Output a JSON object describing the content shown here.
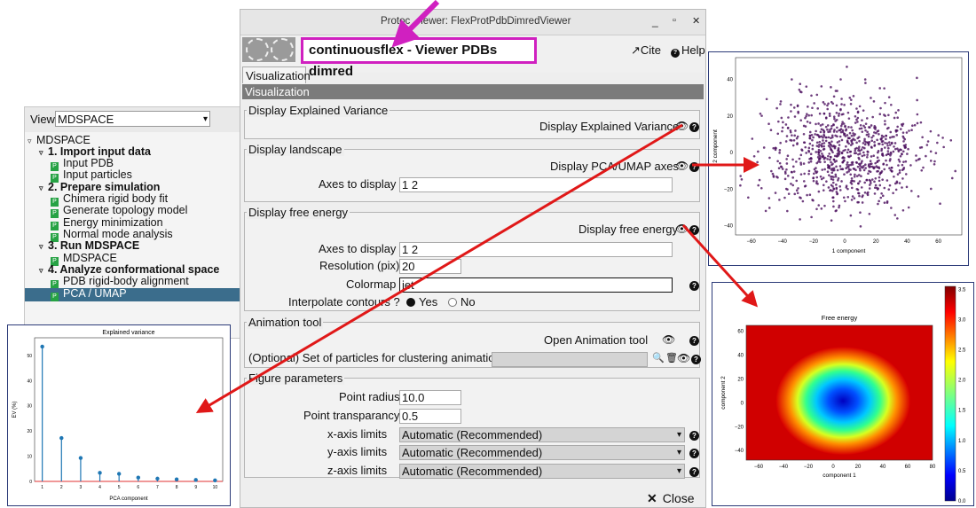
{
  "tree": {
    "view_label": "View",
    "view_value": "MDSPACE",
    "nodes": [
      {
        "label": "MDSPACE",
        "bold": false,
        "toggle": true,
        "proto": false
      },
      {
        "label": "1. Import input data",
        "bold": true,
        "toggle": true,
        "proto": false
      },
      {
        "label": "Input PDB",
        "bold": false,
        "toggle": false,
        "proto": true
      },
      {
        "label": "Input particles",
        "bold": false,
        "toggle": false,
        "proto": true
      },
      {
        "label": "2. Prepare simulation",
        "bold": true,
        "toggle": true,
        "proto": false
      },
      {
        "label": "Chimera rigid body fit",
        "bold": false,
        "toggle": false,
        "proto": true
      },
      {
        "label": "Generate topology model",
        "bold": false,
        "toggle": false,
        "proto": true
      },
      {
        "label": "Energy minimization",
        "bold": false,
        "toggle": false,
        "proto": true
      },
      {
        "label": "Normal mode analysis",
        "bold": false,
        "toggle": false,
        "proto": true
      },
      {
        "label": "3. Run MDSPACE",
        "bold": true,
        "toggle": true,
        "proto": false
      },
      {
        "label": "MDSPACE",
        "bold": false,
        "toggle": false,
        "proto": true
      },
      {
        "label": "4. Analyze conformational space",
        "bold": true,
        "toggle": true,
        "proto": false
      },
      {
        "label": "PDB rigid-body alignment",
        "bold": false,
        "toggle": false,
        "proto": true
      },
      {
        "label": "PCA / UMAP",
        "bold": false,
        "toggle": false,
        "proto": true,
        "selected": true
      }
    ]
  },
  "window": {
    "title_a": "Protoc",
    "title_b": "iewer: FlexProtPdbDimredViewer",
    "min": "_",
    "max": "▫",
    "close": "✕"
  },
  "header": {
    "plugin_title": "continuousflex - Viewer PDBs dimred",
    "cite": "Cite",
    "help": "Help"
  },
  "tab_label": "Visualization",
  "section_label": "Visualization",
  "groups": {
    "explained_variance": {
      "title": "Display Explained Variance",
      "param": "Display Explained Variance"
    },
    "landscape": {
      "title": "Display landscape",
      "param": "Display PCA/UMAP axes",
      "axes_label": "Axes to display",
      "axes_value": "1 2"
    },
    "free_energy": {
      "title": "Display free energy",
      "param": "Display free energy",
      "axes_label": "Axes to display",
      "axes_value": "1 2",
      "res_label": "Resolution (pix)",
      "res_value": "20",
      "cmap_label": "Colormap",
      "cmap_value": "jet",
      "interp_label": "Interpolate contours ?",
      "yes": "Yes",
      "no": "No"
    },
    "animation": {
      "title": "Animation tool",
      "open_label": "Open Animation tool",
      "particles_label": "(Optional) Set of particles for clustering animation"
    },
    "figure": {
      "title": "Figure parameters",
      "radius_label": "Point radius",
      "radius_value": "10.0",
      "transp_label": "Point transparancy",
      "transp_value": "0.5",
      "xlim_label": "x-axis limits",
      "ylim_label": "y-axis limits",
      "zlim_label": "z-axis limits",
      "lim_value": "Automatic (Recommended)"
    }
  },
  "close_label": "Close",
  "charts": {
    "variance": {
      "title": "Explained variance",
      "xlabel": "PCA component",
      "ylabel": "EV (%)",
      "x": [
        1,
        2,
        3,
        4,
        5,
        6,
        7,
        8,
        9,
        10
      ],
      "values": [
        53.5,
        17.2,
        9.3,
        3.4,
        3.0,
        1.5,
        1.1,
        0.8,
        0.6,
        0.4
      ],
      "yticks": [
        "0",
        "10",
        "20",
        "30",
        "40",
        "50"
      ],
      "xticks": [
        "1",
        "2",
        "3",
        "4",
        "5",
        "6",
        "7",
        "8",
        "9",
        "10"
      ]
    },
    "scatter": {
      "xlabel": "1 component",
      "ylabel": "2 component",
      "xticks": [
        "−60",
        "−40",
        "−20",
        "0",
        "20",
        "40",
        "60"
      ],
      "yticks": [
        "40",
        "20",
        "0",
        "−20",
        "−40"
      ]
    },
    "free_energy": {
      "title": "Free energy",
      "xlabel": "component 1",
      "ylabel": "component 2",
      "xticks": [
        "−60",
        "−40",
        "−20",
        "0",
        "20",
        "40",
        "60",
        "80"
      ],
      "yticks": [
        "60",
        "40",
        "20",
        "0",
        "−20",
        "−40"
      ],
      "cbar_ticks": [
        "3.5",
        "3.0",
        "2.5",
        "2.0",
        "1.5",
        "1.0",
        "0.5",
        "0.0"
      ]
    }
  }
}
